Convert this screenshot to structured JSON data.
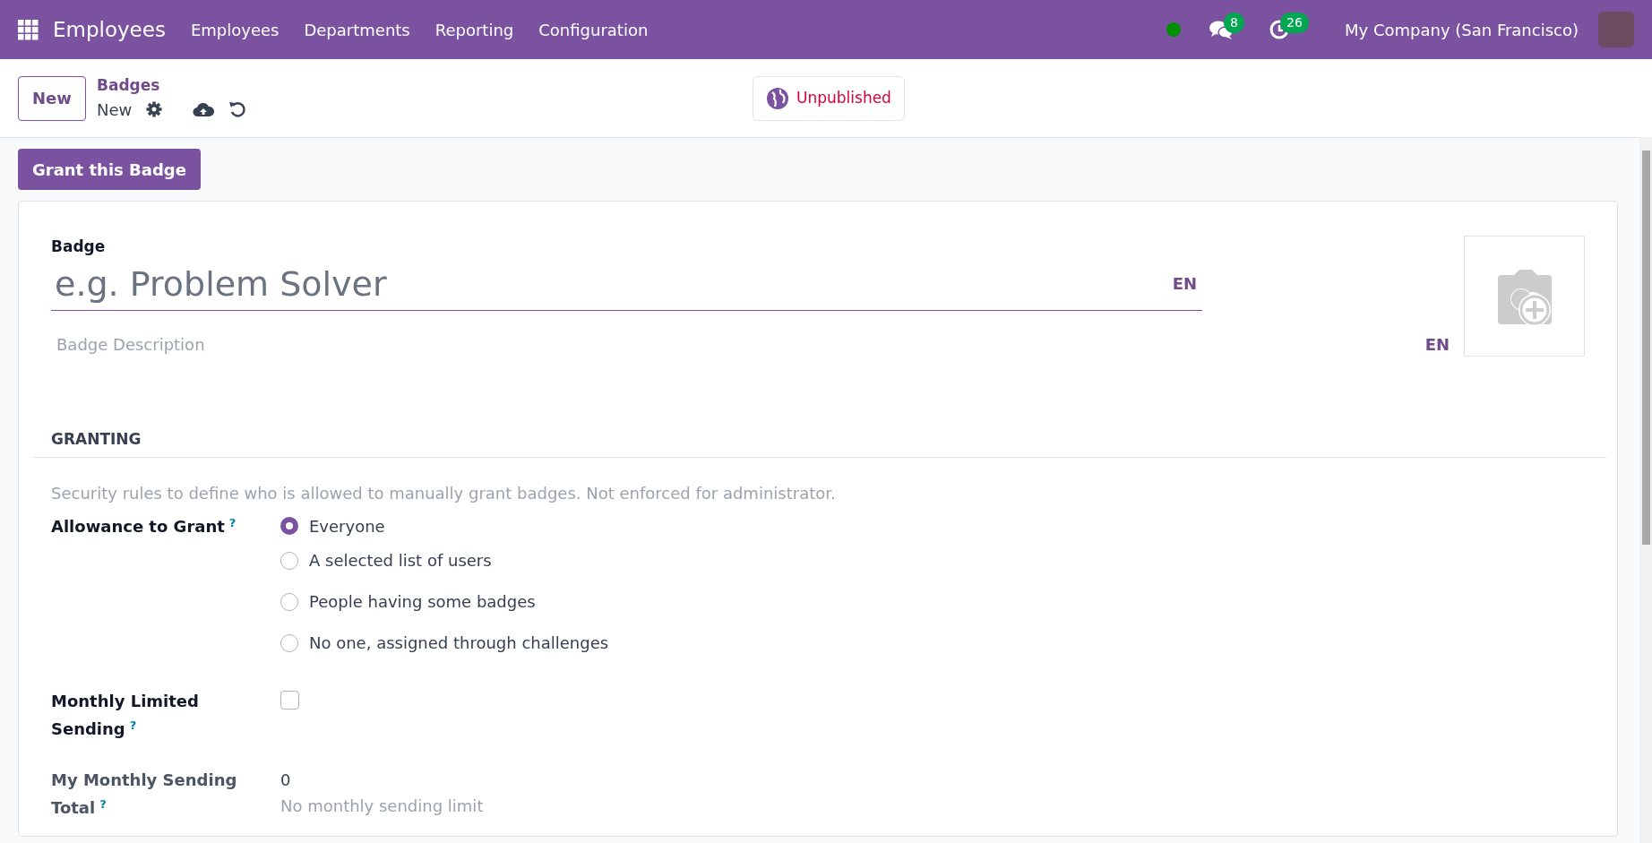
{
  "navbar": {
    "app_name": "Employees",
    "menu": [
      "Employees",
      "Departments",
      "Reporting",
      "Configuration"
    ],
    "messages_count": "8",
    "activities_count": "26",
    "company": "My Company (San Francisco)"
  },
  "control_panel": {
    "new_button": "New",
    "breadcrumb": "Badges",
    "record": "New",
    "publish_status": "Unpublished"
  },
  "actions": [
    "Grant this Badge"
  ],
  "form": {
    "name_label": "Badge",
    "name_placeholder": "e.g. Problem Solver",
    "name_lang": "EN",
    "description_placeholder": "Badge Description",
    "description_lang": "EN",
    "section": "GRANTING",
    "section_help": "Security rules to define who is allowed to manually grant badges. Not enforced for administrator.",
    "fields": [
      {
        "kind": "radio",
        "label": "Allowance to Grant",
        "help": "?",
        "options": [
          {
            "label": "Everyone",
            "selected": true
          },
          {
            "label": "A selected list of users",
            "selected": false
          },
          {
            "label": "People having some badges",
            "selected": false
          },
          {
            "label": "No one, assigned through challenges",
            "selected": false
          }
        ]
      },
      {
        "kind": "checkbox",
        "label": "Monthly Limited Sending",
        "help": "?",
        "checked": false
      },
      {
        "kind": "readonly",
        "label": "My Monthly Sending Total",
        "help": "?",
        "value": "0",
        "note": "No monthly sending limit"
      }
    ]
  }
}
